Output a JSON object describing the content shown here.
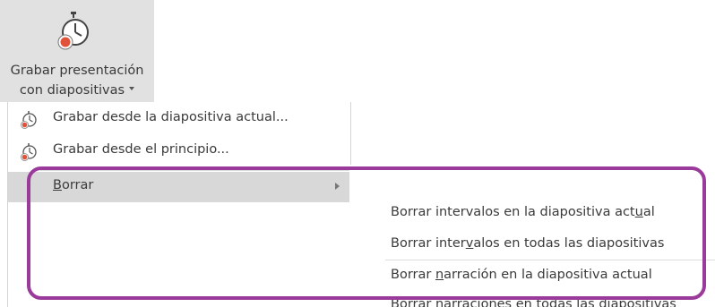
{
  "ribbon": {
    "label_line1": "Grabar presentación",
    "label_line2": "con diapositivas",
    "icon": "record-stopwatch-icon"
  },
  "menu": {
    "items": [
      {
        "label": "Grabar desde la diapositiva actual...",
        "icon": "record-stopwatch-icon"
      },
      {
        "label": "Grabar desde el principio...",
        "icon": "record-stopwatch-icon"
      },
      {
        "label_ul": "B",
        "label_rest": "orrar",
        "has_submenu": true
      }
    ]
  },
  "submenu": {
    "items": [
      {
        "pre": "Borrar intervalos en la diapositiva act",
        "ul": "u",
        "post": "al"
      },
      {
        "pre": "Borrar inter",
        "ul": "v",
        "post": "alos en todas las diapositivas"
      },
      {
        "pre": "Borrar ",
        "ul": "n",
        "post": "arración en la diapositiva actual"
      },
      {
        "pre": "Borrar narraciones en to",
        "ul": "d",
        "post": "as las diapositivas"
      }
    ]
  },
  "colors": {
    "ribbon_bg": "#e1e1e1",
    "highlight_bg": "#d8d8d8",
    "outline": "#9a3a9b",
    "record_red": "#e0533a"
  }
}
